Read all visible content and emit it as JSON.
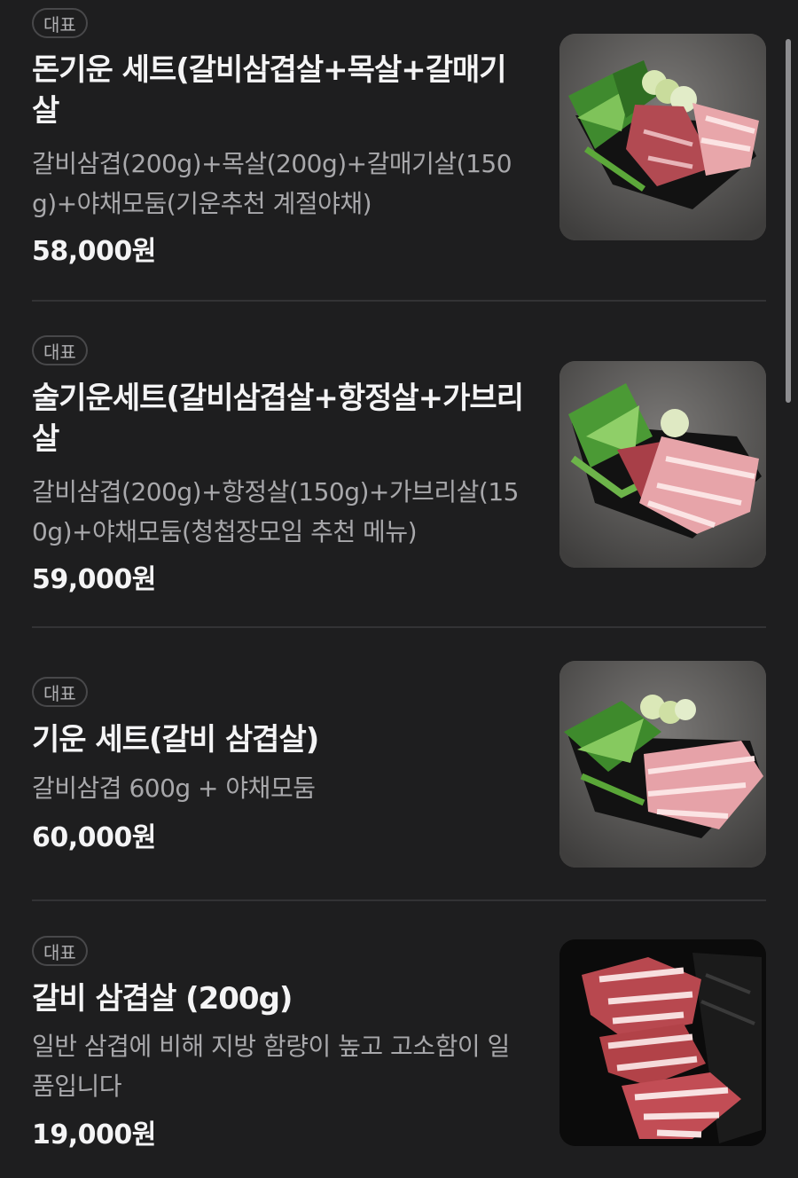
{
  "menu": {
    "items": [
      {
        "badge": "대표",
        "title": "돈기운 세트(갈비삼겹살+목살+갈매기살",
        "description": "갈비삼겹(200g)+목살(200g)+갈매기살(150g)+야채모둠(기운추천 계절야채)",
        "price": "58,000원",
        "image_icon": "grilled-pork-set-photo"
      },
      {
        "badge": "대표",
        "title": "술기운세트(갈비삼겹살+항정살+가브리살",
        "description": "갈비삼겹(200g)+항정살(150g)+가브리살(150g)+야채모둠(청첩장모임 추천 메뉴)",
        "price": "59,000원",
        "image_icon": "grilled-pork-set-photo"
      },
      {
        "badge": "대표",
        "title": "기운 세트(갈비 삼겹살)",
        "description": "갈비삼겹 600g + 야채모둠",
        "price": "60,000원",
        "image_icon": "grilled-pork-set-photo"
      },
      {
        "badge": "대표",
        "title": "갈비 삼겹살 (200g)",
        "description": "일반 삼겹에 비해 지방 함량이 높고 고소함이 일품입니다",
        "price": "19,000원",
        "image_icon": "pork-belly-photo"
      }
    ]
  },
  "colors": {
    "background": "#1e1e1f",
    "title": "#f4f4f5",
    "description": "#a8a8ab",
    "badge_border": "#48484a",
    "divider": "#333335"
  }
}
